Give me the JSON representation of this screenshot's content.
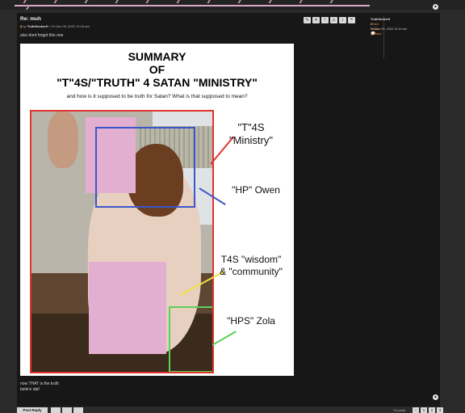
{
  "header": {
    "scroll_top_symbol": "▲"
  },
  "post": {
    "title": "Re: muh",
    "by_prefix": "by",
    "author": "TruthSeeker9",
    "date": "» Fri Dec 09, 2022 12:18 am",
    "text_before": "also dont forget this one",
    "text_after_line1": "now THAT is the truth",
    "text_after_line2": "belie'e dat!",
    "actions": [
      "✎",
      "✕",
      "!",
      "⚠",
      "i",
      "❝"
    ]
  },
  "profile": {
    "username": "TruthSeeker9",
    "posts_label": "Posts:",
    "posts_value": "3",
    "joined_label": "Joined:",
    "joined_value": "Fri Dec 09, 2022 12:14 am",
    "contact_label": "Contact:",
    "contact_icon": "speech-bubble-icon"
  },
  "image": {
    "heading_line1": "SUMMARY",
    "heading_line2": "OF",
    "heading_line3": "\"T\"4S/\"TRUTH\" 4 SATAN \"MINISTRY\"",
    "subtitle_pre": "and how is it supposed to be truth ",
    "subtitle_em": "for",
    "subtitle_post": " Satan? What is that supposed to mean?",
    "label_ministry_1": "\"T\"4S",
    "label_ministry_2": "\"Ministry\"",
    "label_owen": "\"HP\" Owen",
    "label_wisdom_1": "T4S \"wisdom\"",
    "label_wisdom_2": "& \"community\"",
    "label_zola": "\"HPS\" Zola",
    "colors": {
      "red": "#e0352f",
      "blue": "#3b57c9",
      "green": "#5bd05a",
      "yellow": "#f2e23a",
      "censor": "#e2afd0"
    }
  },
  "pagination": {
    "reply_label": "Post Reply",
    "post_count": "76 posts",
    "pages": [
      "‹",
      "1",
      "2",
      "3"
    ]
  }
}
